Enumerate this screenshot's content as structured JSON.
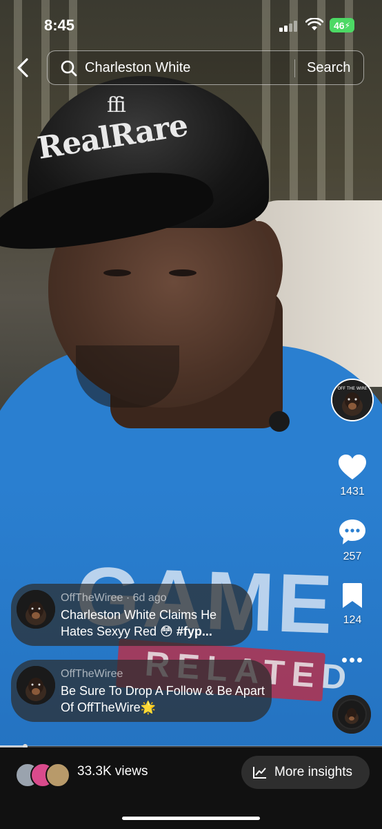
{
  "status_bar": {
    "time": "8:45",
    "battery": "46"
  },
  "search": {
    "query": "Charleston White",
    "button": "Search"
  },
  "video": {
    "cap_text": "RealRare",
    "cap_logo": "ffi",
    "shirt_text": "GAME",
    "shirt_text2": "RELATED"
  },
  "rail": {
    "likes": "1431",
    "comments": "257",
    "saves": "124"
  },
  "comments": [
    {
      "author": "OffTheWiree · 6d ago",
      "text": "Charleston White Claims He Hates Sexyy Red 😳",
      "hashtag": "#fyp..."
    },
    {
      "author": "OffTheWiree",
      "text": "Be Sure To Drop A Follow & Be Apart Of OffTheWire🌟"
    }
  ],
  "playback": {
    "progress_fraction": 0.065
  },
  "footer": {
    "views": "33.3K views",
    "insights": "More insights"
  },
  "colors": {
    "battery": "#4cd964",
    "shirt": "#2a7fd0"
  }
}
